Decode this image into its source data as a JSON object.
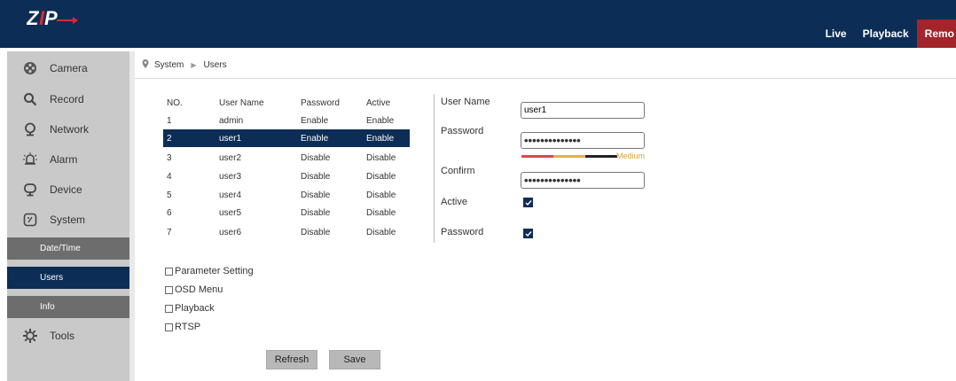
{
  "header": {
    "logo_text": "ZIP",
    "nav": [
      {
        "label": "Live"
      },
      {
        "label": "Playback"
      },
      {
        "label": "Remo"
      }
    ],
    "active_color": "#a3242b",
    "bg_color": "#0c2d55"
  },
  "sidebar": {
    "items": [
      {
        "label": "Camera",
        "icon": "camera-icon"
      },
      {
        "label": "Record",
        "icon": "search-icon"
      },
      {
        "label": "Network",
        "icon": "network-icon"
      },
      {
        "label": "Alarm",
        "icon": "alarm-icon"
      },
      {
        "label": "Device",
        "icon": "device-icon"
      },
      {
        "label": "System",
        "icon": "system-icon"
      },
      {
        "label": "Tools",
        "icon": "gear-icon"
      }
    ],
    "subitems": [
      {
        "label": "Date/Time"
      },
      {
        "label": "Users"
      },
      {
        "label": "Info"
      }
    ]
  },
  "breadcrumb": {
    "root": "System",
    "current": "Users"
  },
  "user_table": {
    "headers": [
      "NO.",
      "User Name",
      "Password",
      "Active"
    ],
    "rows": [
      [
        "1",
        "admin",
        "Enable",
        "Enable"
      ],
      [
        "2",
        "user1",
        "Enable",
        "Enable"
      ],
      [
        "3",
        "user2",
        "Disable",
        "Disable"
      ],
      [
        "4",
        "user3",
        "Disable",
        "Disable"
      ],
      [
        "5",
        "user4",
        "Disable",
        "Disable"
      ],
      [
        "6",
        "user5",
        "Disable",
        "Disable"
      ],
      [
        "7",
        "user6",
        "Disable",
        "Disable"
      ]
    ],
    "selected_row": 2
  },
  "form": {
    "username_label": "User Name",
    "username_value": "user1",
    "password_label": "Password",
    "password_value": "••••••••••••••",
    "strength_label": "Medium",
    "confirm_label": "Confirm",
    "confirm_value": "••••••••••••••",
    "active_label": "Active",
    "active_checked": true,
    "password_enable_label": "Password",
    "password_enable_checked": true
  },
  "permissions": [
    {
      "label": "Parameter Setting",
      "checked": false
    },
    {
      "label": "OSD Menu",
      "checked": false
    },
    {
      "label": "Playback",
      "checked": false
    },
    {
      "label": "RTSP",
      "checked": false
    }
  ],
  "buttons": {
    "refresh": "Refresh",
    "save": "Save"
  }
}
